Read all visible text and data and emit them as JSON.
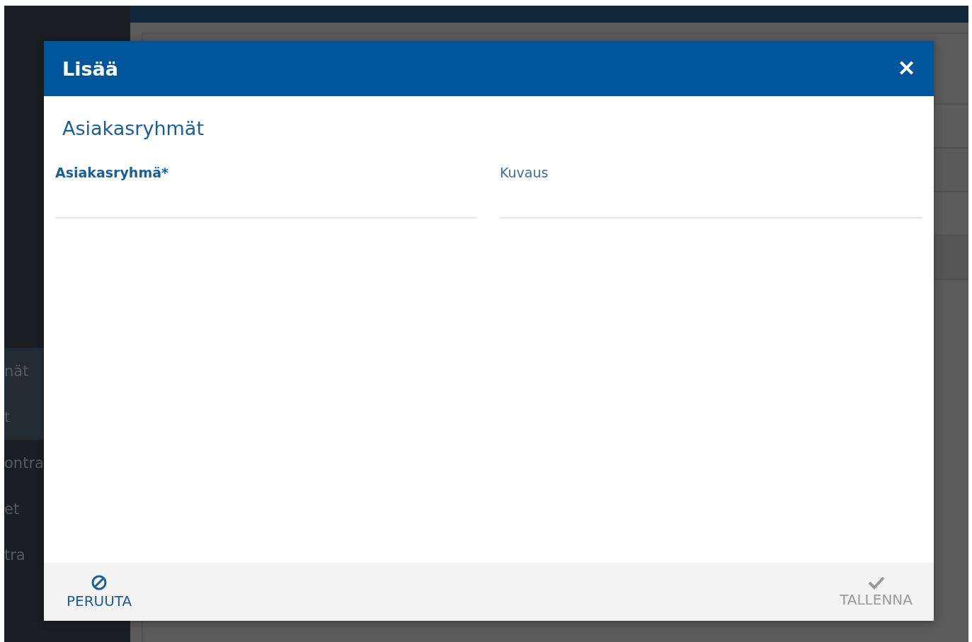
{
  "sidebar": {
    "items": [
      {
        "label": "nät",
        "selected": true
      },
      {
        "label": "t",
        "selected": true
      },
      {
        "label": "ontra",
        "selected": false
      },
      {
        "label": "et",
        "selected": false
      },
      {
        "label": "tra",
        "selected": false
      }
    ]
  },
  "dialog": {
    "title": "Lisää",
    "close": "✕",
    "section_title": "Asiakasryhmät",
    "fields": [
      {
        "label": "Asiakasryhmä*",
        "required": true
      },
      {
        "label": "Kuvaus",
        "required": false
      }
    ],
    "buttons": [
      {
        "kind": "cancel",
        "label": "PERUUTA",
        "disabled": false
      },
      {
        "kind": "save",
        "label": "TALLENNA",
        "disabled": true
      }
    ]
  }
}
